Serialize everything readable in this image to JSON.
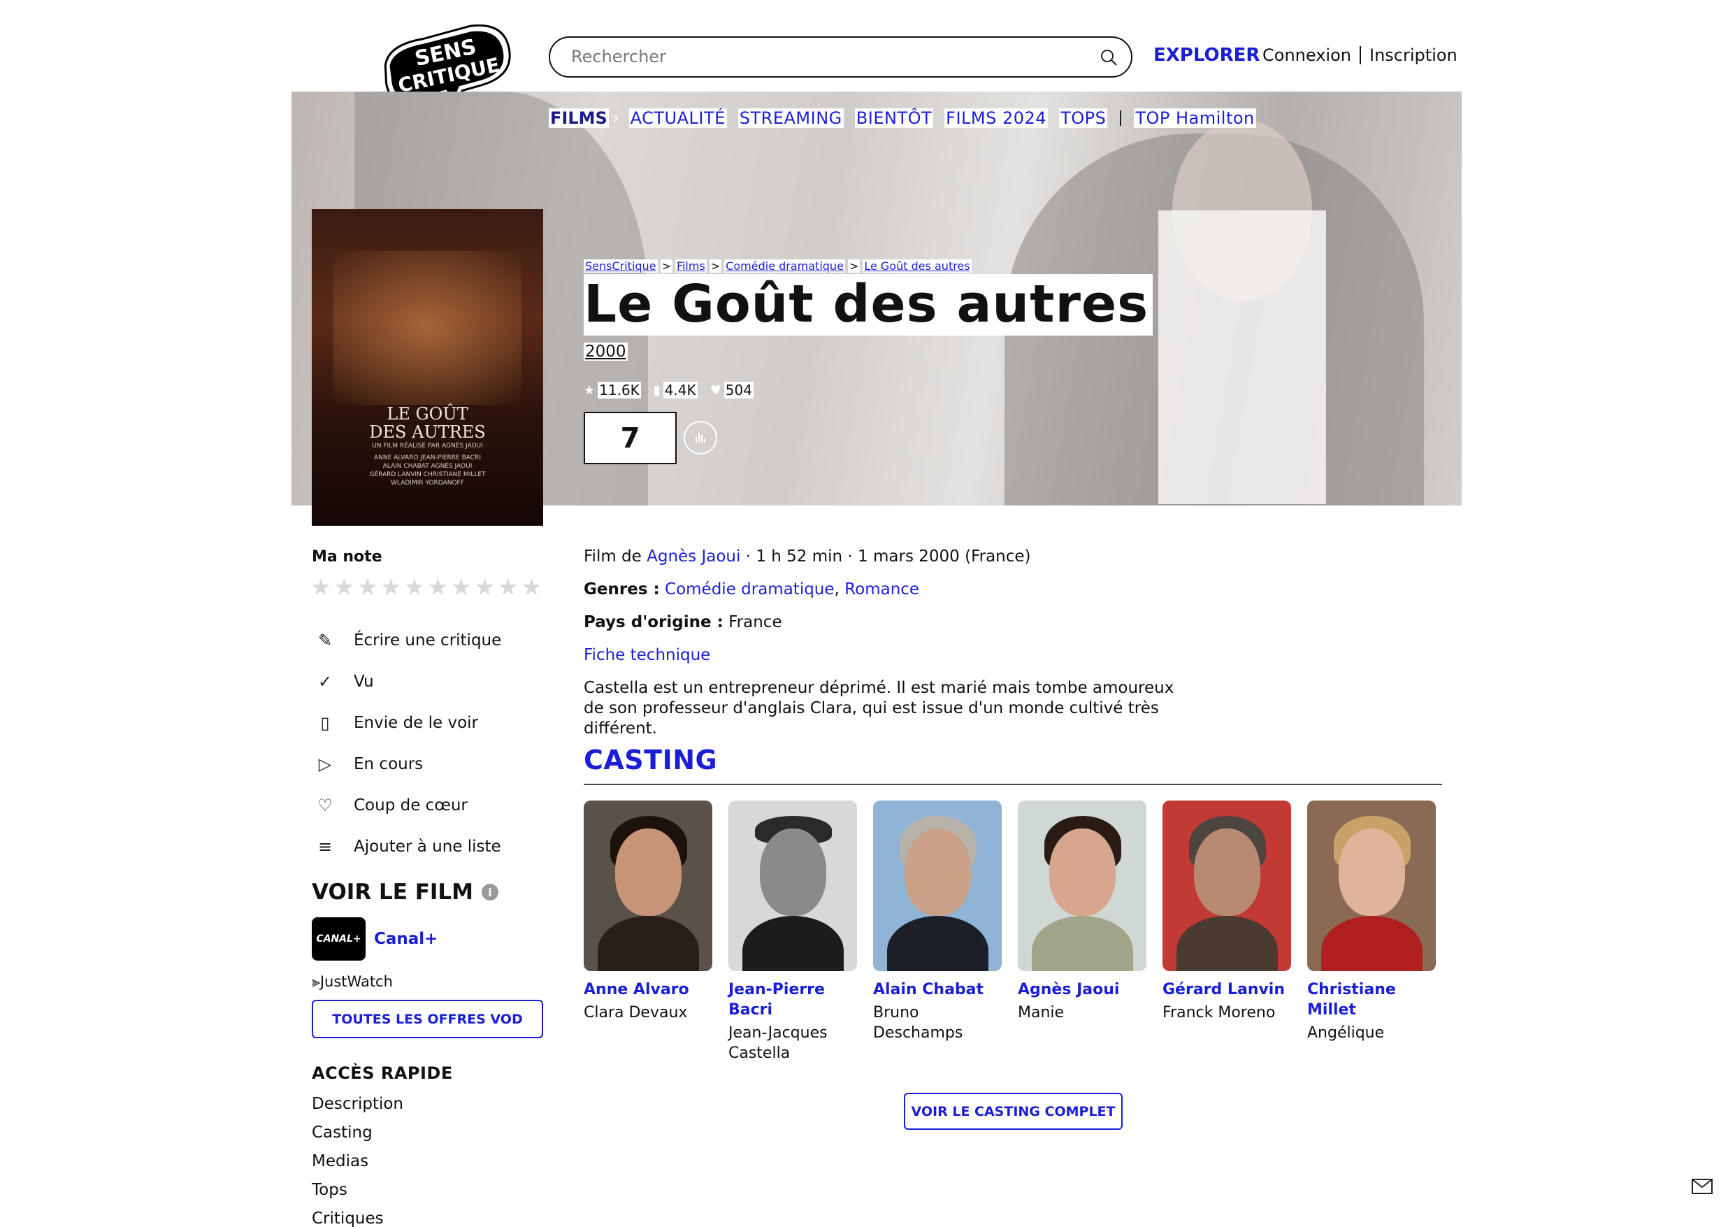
{
  "header": {
    "logo_text": "SENS CRITIQUE",
    "search_placeholder": "Rechercher",
    "explorer": "EXPLORER",
    "connexion": "Connexion",
    "inscription": "Inscription"
  },
  "nav": {
    "films": "FILMS",
    "items": [
      "ACTUALITÉ",
      "STREAMING",
      "BIENTÔT",
      "FILMS 2024",
      "TOPS"
    ],
    "top": "TOP Hamilton"
  },
  "breadcrumb": [
    "SensCritique",
    "Films",
    "Comédie dramatique",
    "Le Goût des autres"
  ],
  "movie": {
    "title": "Le Goût des autres",
    "year": "2000",
    "ratings_count": "11.6K",
    "wishlist_count": "4.4K",
    "likes_count": "504",
    "score": "7",
    "poster": {
      "title_line1": "LE GOÛT",
      "title_line2": "DES AUTRES",
      "subtitle": "UN FILM RÉALISÉ PAR AGNÈS JAOUI",
      "cast_lines": [
        "ANNE ALVARO JEAN-PIERRE BACRI",
        "ALAIN CHABAT AGNÈS JAOUI",
        "GÉRARD LANVIN CHRISTIANE MILLET",
        "WLADIMIR YORDANOFF"
      ]
    }
  },
  "sidebar": {
    "my_rating": "Ma note",
    "stars": [
      "★",
      "★",
      "★",
      "★",
      "★",
      "★",
      "★",
      "★",
      "★",
      "★"
    ],
    "actions": [
      {
        "icon": "pencil-icon",
        "glyph": "✎",
        "label": "Écrire une critique"
      },
      {
        "icon": "check-icon",
        "glyph": "✓",
        "label": "Vu"
      },
      {
        "icon": "bookmark-icon",
        "glyph": "▯",
        "label": "Envie de le voir"
      },
      {
        "icon": "play-icon",
        "glyph": "▷",
        "label": "En cours"
      },
      {
        "icon": "heart-icon",
        "glyph": "♡",
        "label": "Coup de cœur"
      },
      {
        "icon": "list-add-icon",
        "glyph": "≡",
        "label": "Ajouter à une liste"
      }
    ],
    "watch_title": "VOIR LE FILM",
    "provider_logo": "CANAL+",
    "provider": "Canal+",
    "justwatch": "JustWatch",
    "vod_button": "TOUTES LES OFFRES VOD",
    "quick_access_title": "ACCÈS RAPIDE",
    "quick_links": [
      "Description",
      "Casting",
      "Medias",
      "Tops",
      "Critiques"
    ]
  },
  "details": {
    "film_de": "Film de",
    "director": "Agnès Jaoui",
    "meta": "· 1 h 52 min · 1 mars 2000 (France)",
    "genres_label": "Genres :",
    "genre1": "Comédie dramatique",
    "genre_sep": ",",
    "genre2": "Romance",
    "country_label": "Pays d'origine :",
    "country": "France",
    "fiche": "Fiche technique",
    "synopsis": "Castella est un entrepreneur déprimé. Il est marié mais tombe amoureux de son professeur d'anglais Clara, qui est issue d'un monde cultivé très différent."
  },
  "casting": {
    "title": "CASTING",
    "actors": [
      {
        "name": "Anne Alvaro",
        "role": "Clara Devaux"
      },
      {
        "name": "Jean-Pierre Bacri",
        "role": "Jean-Jacques Castella"
      },
      {
        "name": "Alain Chabat",
        "role": "Bruno Deschamps"
      },
      {
        "name": "Agnès Jaoui",
        "role": "Manie"
      },
      {
        "name": "Gérard Lanvin",
        "role": "Franck Moreno"
      },
      {
        "name": "Christiane Millet",
        "role": "Angélique"
      }
    ],
    "full_button": "VOIR LE CASTING COMPLET"
  },
  "colors": {
    "accent": "#1a1fd6",
    "nav_active": "#1d1a8a"
  }
}
